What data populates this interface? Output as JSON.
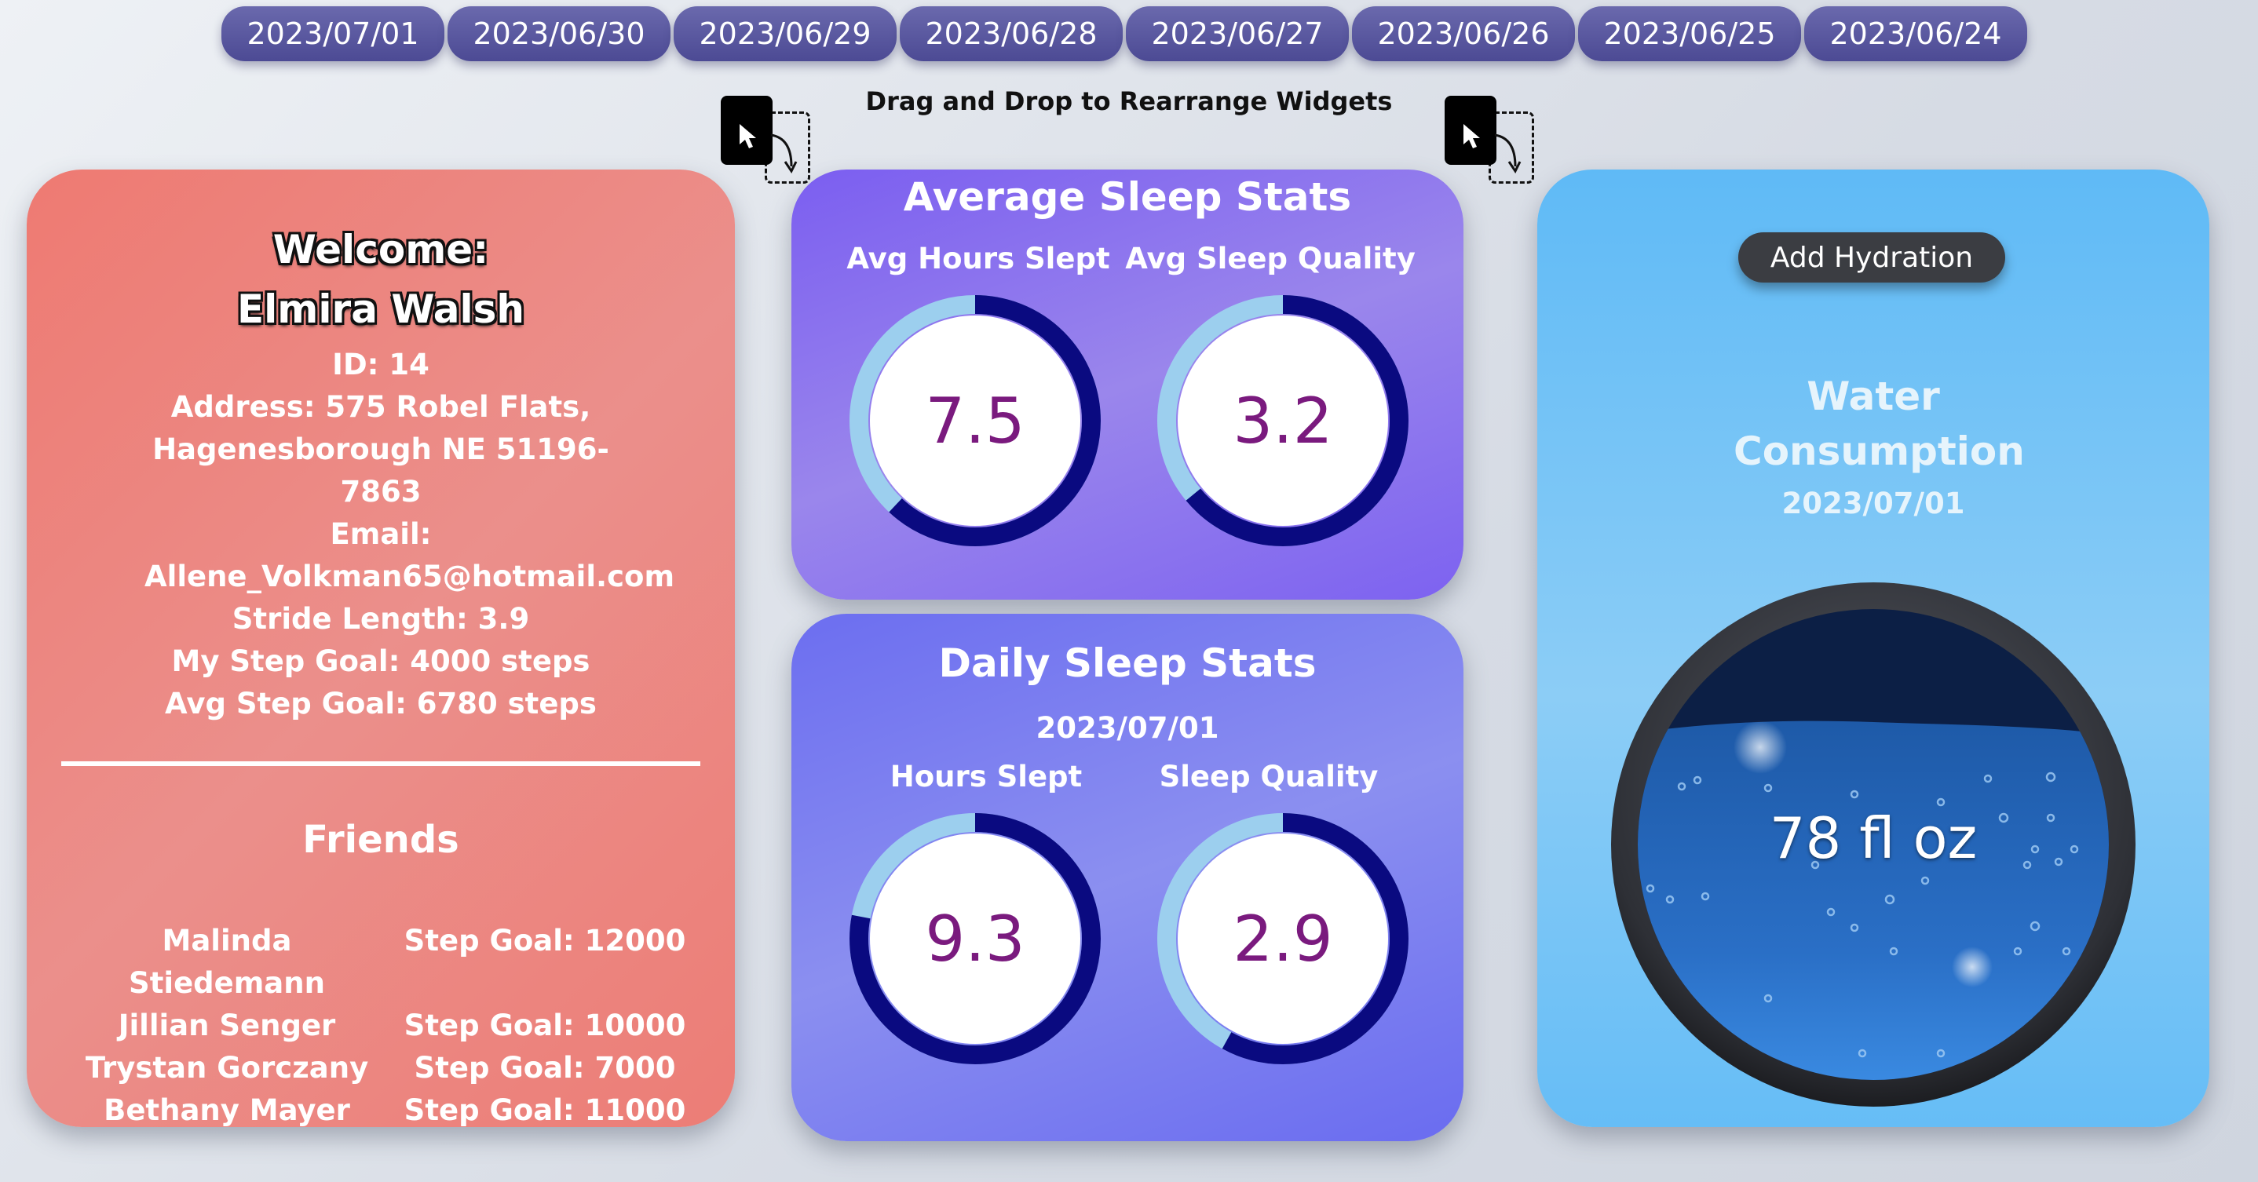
{
  "dates": [
    "2023/07/01",
    "2023/06/30",
    "2023/06/29",
    "2023/06/28",
    "2023/06/27",
    "2023/06/26",
    "2023/06/25",
    "2023/06/24"
  ],
  "drag_hint": "Drag and Drop to Rearrange Widgets",
  "user": {
    "welcome": "Welcome: Elmira Walsh",
    "id": "ID: 14",
    "address": "Address: 575 Robel Flats, Hagenesborough NE 51196-7863",
    "email_label": "Email:",
    "email": "Allene_Volkman65@hotmail.com",
    "stride": "Stride Length: 3.9",
    "step_goal": "My Step Goal: 4000 steps",
    "avg_step_goal": "Avg Step Goal: 6780 steps"
  },
  "friends": {
    "title": "Friends",
    "items": [
      {
        "name": "Malinda Stiedemann",
        "goal": "Step Goal: 12000"
      },
      {
        "name": "Jillian Senger",
        "goal": "Step Goal: 10000"
      },
      {
        "name": "Trystan Gorczany",
        "goal": "Step Goal: 7000"
      },
      {
        "name": "Bethany Mayer",
        "goal": "Step Goal: 11000"
      }
    ]
  },
  "avg_sleep": {
    "title": "Average Sleep Stats",
    "hours_label": "Avg Hours Slept",
    "hours_value": "7.5",
    "hours_fraction": 0.62,
    "quality_label": "Avg Sleep Quality",
    "quality_value": "3.2",
    "quality_fraction": 0.64
  },
  "daily_sleep": {
    "title": "Daily Sleep Stats",
    "date": "2023/07/01",
    "hours_label": "Hours Slept",
    "hours_value": "9.3",
    "hours_fraction": 0.78,
    "quality_label": "Sleep Quality",
    "quality_value": "2.9",
    "quality_fraction": 0.58
  },
  "water": {
    "button": "Add Hydration",
    "title": "Water Consumption",
    "date": "2023/07/01",
    "amount": "78 fl oz",
    "fill_fraction": 0.75
  },
  "colors": {
    "gauge_track": "#9ccfee",
    "gauge_fill": "#0a0a80",
    "gauge_value": "#7a1a7e"
  }
}
